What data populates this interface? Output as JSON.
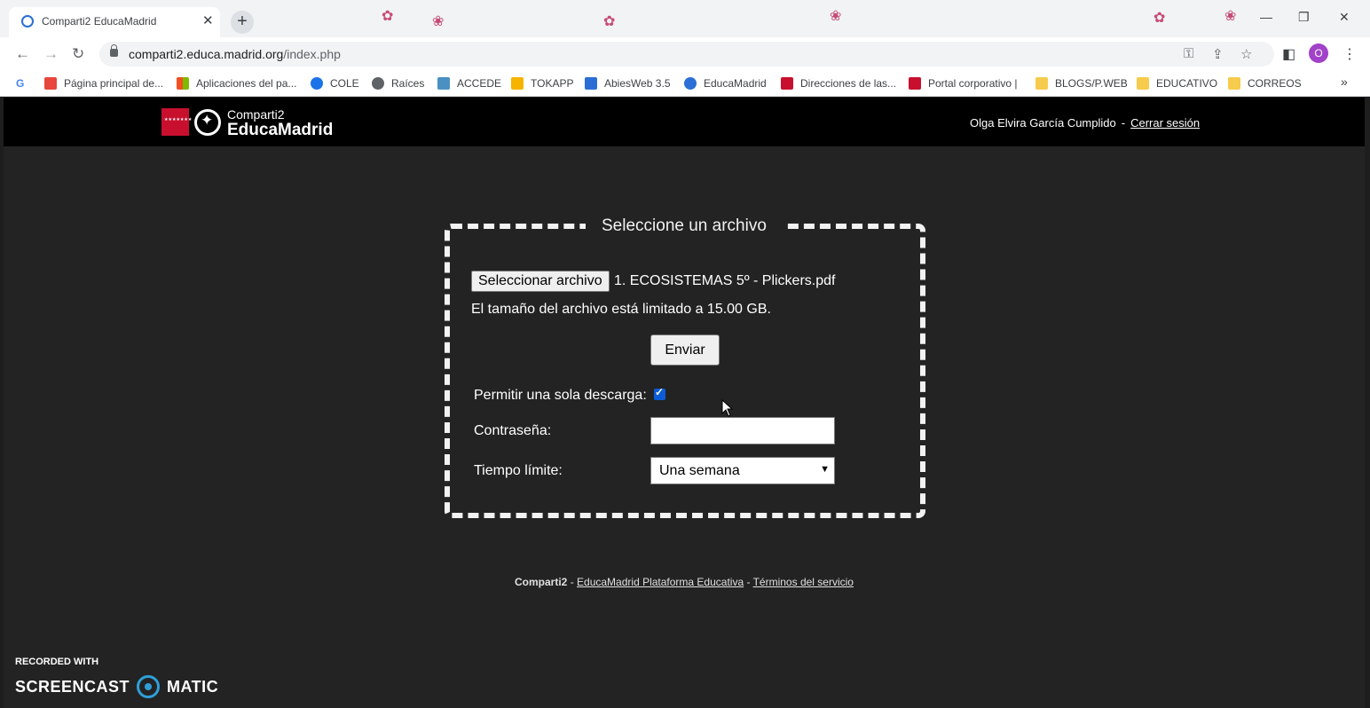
{
  "browser": {
    "tab_title": "Comparti2 EducaMadrid",
    "url_host": "comparti2.educa.madrid.org",
    "url_path": "/index.php",
    "profile_initial": "O",
    "bookmarks": [
      {
        "label": "Página principal de...",
        "color": "#e8453c"
      },
      {
        "label": "Aplicaciones del pa...",
        "color": "#f29900"
      },
      {
        "label": "COLE",
        "color": "#1a73e8"
      },
      {
        "label": "Raíces",
        "color": "#5f6368"
      },
      {
        "label": "ACCEDE",
        "color": "#4a90c2"
      },
      {
        "label": "TOKAPP",
        "color": "#f6b400"
      },
      {
        "label": "AbiesWeb 3.5",
        "color": "#2b6fd6"
      },
      {
        "label": "EducaMadrid",
        "color": "#2b6fd6"
      },
      {
        "label": "Direcciones de las...",
        "color": "#c8102e"
      },
      {
        "label": "Portal corporativo |",
        "color": "#c8102e"
      },
      {
        "label": "BLOGS/P.WEB",
        "color": "#f7cb4d"
      },
      {
        "label": "EDUCATIVO",
        "color": "#f7cb4d"
      },
      {
        "label": "CORREOS",
        "color": "#f7cb4d"
      }
    ]
  },
  "header": {
    "logo_small": "Comparti2",
    "logo_big": "EducaMadrid",
    "user_name": "Olga Elvira García Cumplido",
    "separator": "-",
    "logout_label": "Cerrar sesión"
  },
  "upload": {
    "legend": "Seleccione un archivo",
    "file_button": "Seleccionar archivo",
    "file_name": "1. ECOSISTEMAS 5º - Plickers.pdf",
    "size_limit": "El tamaño del archivo está limitado a 15.00 GB.",
    "send_button": "Enviar",
    "single_download_label": "Permitir una sola descarga:",
    "single_download_checked": true,
    "password_label": "Contraseña:",
    "password_value": "",
    "time_limit_label": "Tiempo límite:",
    "time_limit_value": "Una semana"
  },
  "footer": {
    "brand": "Comparti2",
    "sep": " - ",
    "link1": "EducaMadrid Plataforma Educativa",
    "link2": "Términos del servicio"
  },
  "watermark": {
    "line1": "RECORDED WITH",
    "left": "SCREENCAST",
    "right": "MATIC"
  }
}
